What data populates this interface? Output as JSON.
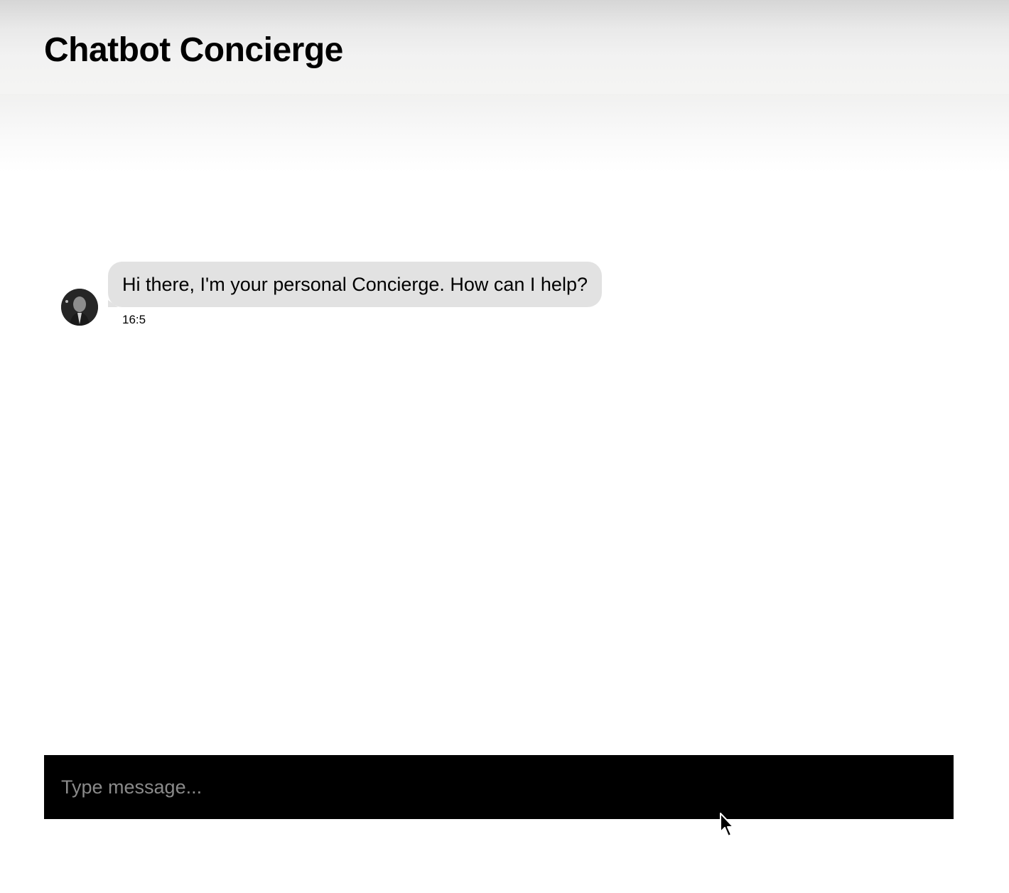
{
  "header": {
    "title": "Chatbot Concierge"
  },
  "conversation": {
    "messages": [
      {
        "sender": "bot",
        "text": "Hi there, I'm your personal Concierge. How can I help?",
        "time": "16:5"
      }
    ]
  },
  "composer": {
    "placeholder": "Type message...",
    "value": ""
  },
  "colors": {
    "bubble_bot": "#e2e2e2",
    "composer_bg": "#000000",
    "placeholder": "#8a8a8a"
  },
  "icons": {
    "avatar": "concierge-avatar",
    "pointer": "mouse-pointer-icon"
  }
}
